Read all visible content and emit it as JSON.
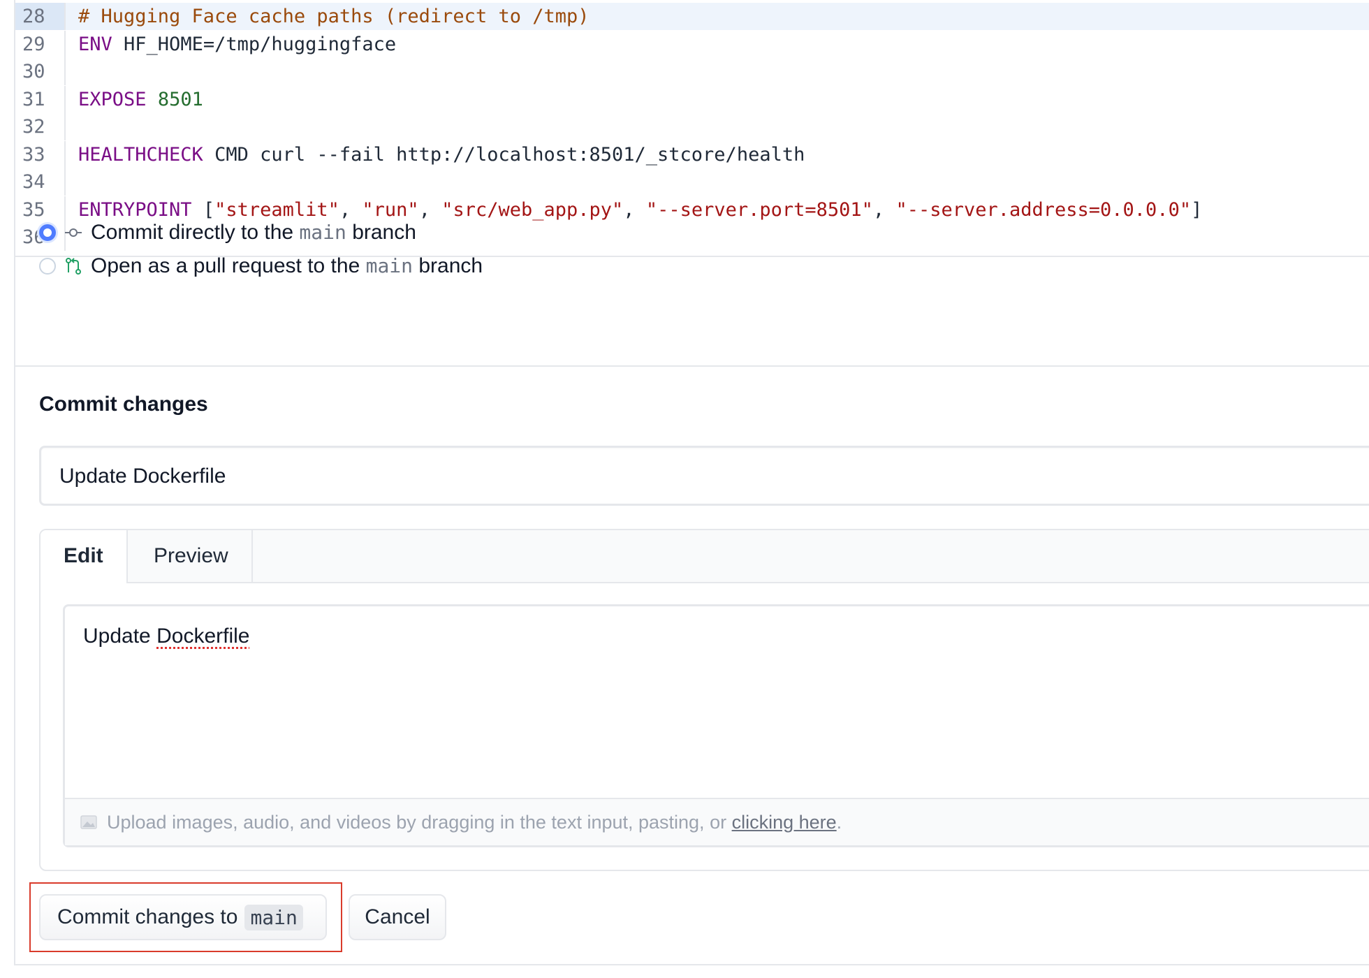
{
  "editor": {
    "lines": [
      {
        "no": "28",
        "tokens": [
          {
            "t": "# Hugging Face cache paths (redirect to /tmp)",
            "c": "cm"
          }
        ]
      },
      {
        "no": "29",
        "tokens": [
          {
            "t": "ENV",
            "c": "kw"
          },
          {
            "t": " HF_HOME=/tmp/huggingface",
            "c": "plain"
          }
        ]
      },
      {
        "no": "30",
        "tokens": []
      },
      {
        "no": "31",
        "tokens": [
          {
            "t": "EXPOSE",
            "c": "kw"
          },
          {
            "t": " ",
            "c": "plain"
          },
          {
            "t": "8501",
            "c": "num"
          }
        ]
      },
      {
        "no": "32",
        "tokens": []
      },
      {
        "no": "33",
        "tokens": [
          {
            "t": "HEALTHCHECK",
            "c": "kw"
          },
          {
            "t": " CMD curl --fail http://localhost:8501/_stcore/health",
            "c": "plain"
          }
        ]
      },
      {
        "no": "34",
        "tokens": []
      },
      {
        "no": "35",
        "tokens": [
          {
            "t": "ENTRYPOINT",
            "c": "kw"
          },
          {
            "t": " [",
            "c": "plain"
          },
          {
            "t": "\"streamlit\"",
            "c": "str"
          },
          {
            "t": ", ",
            "c": "plain"
          },
          {
            "t": "\"run\"",
            "c": "str"
          },
          {
            "t": ", ",
            "c": "plain"
          },
          {
            "t": "\"src/web_app.py\"",
            "c": "str"
          },
          {
            "t": ", ",
            "c": "plain"
          },
          {
            "t": "\"--server.port=8501\"",
            "c": "str"
          },
          {
            "t": ", ",
            "c": "plain"
          },
          {
            "t": "\"--server.address=0.0.0.0\"",
            "c": "str"
          },
          {
            "t": "]",
            "c": "plain"
          }
        ]
      },
      {
        "no": "36",
        "tokens": []
      }
    ]
  },
  "branch_choice": {
    "direct": {
      "prefix": "Commit directly to the ",
      "branch": "main",
      "suffix": " branch",
      "selected": true
    },
    "pull_request": {
      "prefix": "Open as a pull request to the ",
      "branch": "main",
      "suffix": " branch",
      "selected": false
    }
  },
  "commit": {
    "title": "Commit changes",
    "summary_value": "Update Dockerfile",
    "tabs": {
      "edit": "Edit",
      "preview": "Preview"
    },
    "description": {
      "word1": "Update",
      "word2": "Dockerfile"
    },
    "upload_hint": "Upload images, audio, and videos by dragging in the text input, pasting, or ",
    "upload_link": "clicking here",
    "upload_end": "."
  },
  "buttons": {
    "commit_label": "Commit changes to",
    "commit_branch": "main",
    "cancel_label": "Cancel"
  },
  "colors": {
    "keyword": "#7a0e86",
    "comment": "#9a4a0c",
    "number": "#256d2f",
    "string": "#a31515",
    "radio_selected": "#4f7cff",
    "highlight_box": "#d93b2b"
  },
  "icons": {
    "direct": "commit-icon",
    "pull_request": "pull-request-icon",
    "upload": "image-icon"
  }
}
